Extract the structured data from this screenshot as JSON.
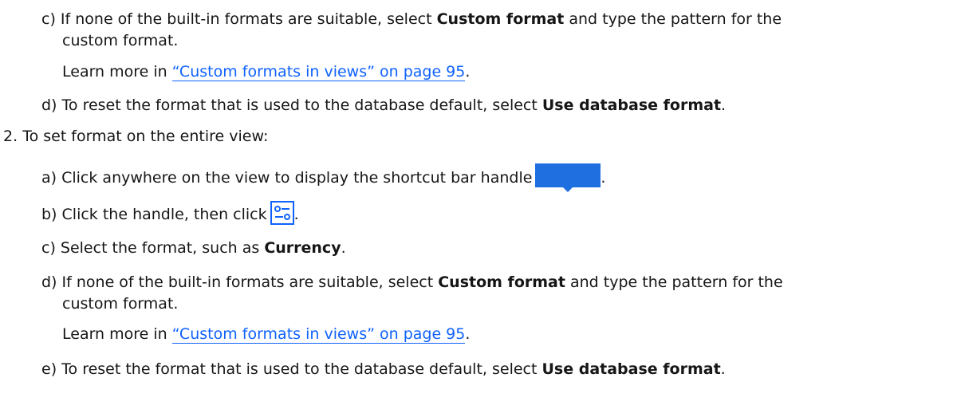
{
  "items": {
    "c1": {
      "marker": "c)",
      "pre": "If none of the built-in formats are suitable, select ",
      "bold": "Custom format",
      "post": " and type the pattern for the",
      "cont": "custom format."
    },
    "learn1": {
      "pre": "Learn more in ",
      "link": "“Custom formats in views” on page 95",
      "post": "."
    },
    "d1": {
      "marker": "d)",
      "pre": "To reset the format that is used to the database default, select ",
      "bold": "Use database format",
      "post": "."
    },
    "step2": {
      "marker": "2.",
      "text": "To set format on the entire view:"
    },
    "a2": {
      "marker": "a)",
      "text": "Click anywhere on the view to display the shortcut bar handle",
      "post": "."
    },
    "b2": {
      "marker": "b)",
      "text": "Click the handle, then click",
      "post": "."
    },
    "c2": {
      "marker": "c)",
      "pre": "Select the format, such as ",
      "bold": "Currency",
      "post": "."
    },
    "d2": {
      "marker": "d)",
      "pre": "If none of the built-in formats are suitable, select ",
      "bold": "Custom format",
      "post": " and type the pattern for the",
      "cont": "custom format."
    },
    "learn2": {
      "pre": "Learn more in ",
      "link": "“Custom formats in views” on page 95",
      "post": "."
    },
    "e2": {
      "marker": "e)",
      "pre": "To reset the format that is used to the database default, select ",
      "bold": "Use database format",
      "post": "."
    }
  },
  "icons": {
    "handle": "shortcut-bar-handle-icon",
    "format": "format-settings-icon"
  },
  "colors": {
    "link": "#0f62fe",
    "handle": "#1f6fe0",
    "icon_border": "#0f62fe"
  }
}
